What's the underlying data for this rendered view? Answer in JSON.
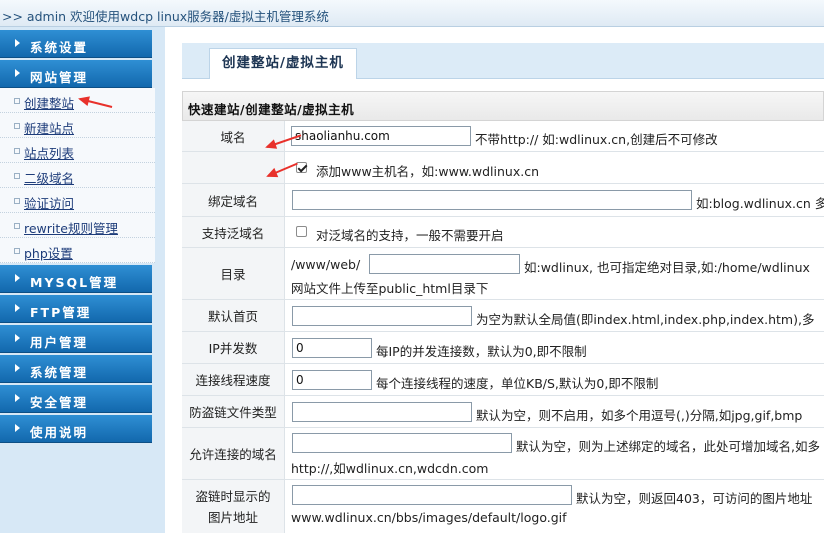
{
  "header": {
    "title": ">> admin 欢迎使用wdcp linux服务器/虚拟主机管理系统"
  },
  "sidebar": {
    "sections": [
      {
        "label": "系统设置"
      },
      {
        "label": "网站管理"
      },
      {
        "label": "MYSQL管理"
      },
      {
        "label": "FTP管理"
      },
      {
        "label": "用户管理"
      },
      {
        "label": "系统管理"
      },
      {
        "label": "安全管理"
      },
      {
        "label": "使用说明"
      }
    ],
    "subitems": [
      {
        "label": "创建整站"
      },
      {
        "label": "新建站点"
      },
      {
        "label": "站点列表"
      },
      {
        "label": "二级域名"
      },
      {
        "label": "验证访问"
      },
      {
        "label": "rewrite规则管理"
      },
      {
        "label": "php设置"
      }
    ]
  },
  "tab": {
    "label": "创建整站/虚拟主机"
  },
  "form": {
    "title": "快速建站/创建整站/虚拟主机",
    "domain": {
      "label": "域名",
      "value": "shaolianhu.com",
      "hint": "不带http:// 如:wdlinux.cn,创建后不可修改"
    },
    "www": {
      "checked": true,
      "text": "添加www主机名，如:www.wdlinux.cn"
    },
    "bind_domain": {
      "label": "绑定域名",
      "value": "",
      "hint": "如:blog.wdlinux.cn 多"
    },
    "wildcard": {
      "label": "支持泛域名",
      "checked": false,
      "text": "对泛域名的支持，一般不需要开启"
    },
    "directory": {
      "label": "目录",
      "prefix": "/www/web/",
      "value": "",
      "hint": "如:wdlinux, 也可指定绝对目录,如:/home/wdlinux",
      "hint2": "网站文件上传至public_html目录下"
    },
    "index": {
      "label": "默认首页",
      "value": "",
      "hint": "为空为默认全局值(即index.html,index.php,index.htm),多"
    },
    "ip_conn": {
      "label": "IP并发数",
      "value": "0",
      "hint": "每IP的并发连接数，默认为0,即不限制"
    },
    "speed": {
      "label": "连接线程速度",
      "value": "0",
      "hint": "每个连接线程的速度，单位KB/S,默认为0,即不限制"
    },
    "hotlink_types": {
      "label": "防盗链文件类型",
      "value": "",
      "hint": "默认为空，则不启用，如多个用逗号(,)分隔,如jpg,gif,bmp"
    },
    "allowed_domains": {
      "label": "允许连接的域名",
      "value": "",
      "hint": "默认为空，则为上述绑定的域名，此处可增加域名,如多",
      "hint2": "http://,如wdlinux.cn,wdcdn.com"
    },
    "hotlink_image": {
      "label": "盗链时显示的图片地址",
      "value": "",
      "hint": "默认为空，则返回403，可访问的图片地址",
      "hint2": "www.wdlinux.cn/bbs/images/default/logo.gif"
    }
  }
}
